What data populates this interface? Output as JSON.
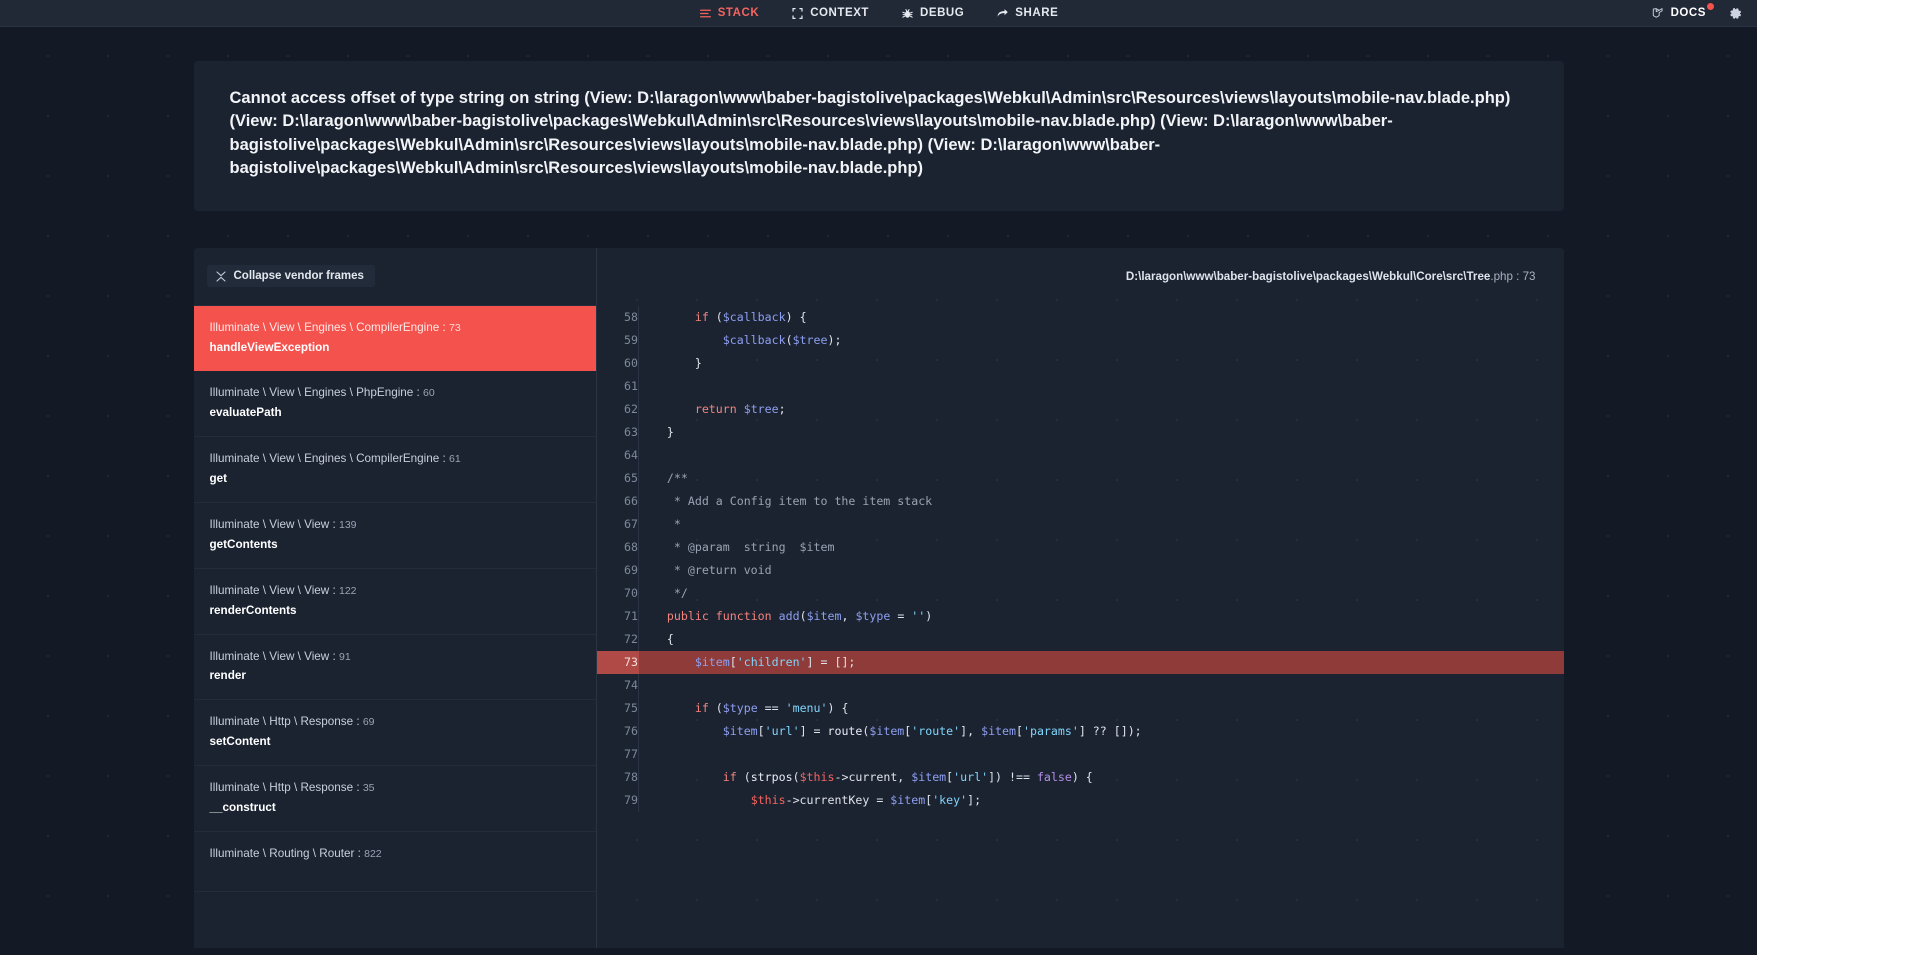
{
  "nav": {
    "items": [
      {
        "label": "STACK",
        "icon": "stack-icon",
        "active": true
      },
      {
        "label": "CONTEXT",
        "icon": "context-icon",
        "active": false
      },
      {
        "label": "DEBUG",
        "icon": "debug-icon",
        "active": false
      },
      {
        "label": "SHARE",
        "icon": "share-icon",
        "active": false
      }
    ],
    "docs_label": "DOCS",
    "docs_icon": "laravel-logo-icon",
    "docs_badge": true,
    "settings_icon": "gear-icon",
    "active_color": "#f4645f"
  },
  "exception": {
    "message": "Cannot access offset of type string on string (View: D:\\laragon\\www\\baber-bagistolive\\packages\\Webkul\\Admin\\src\\Resources\\views\\layouts\\mobile-nav.blade.php) (View: D:\\laragon\\www\\baber-bagistolive\\packages\\Webkul\\Admin\\src\\Resources\\views\\layouts\\mobile-nav.blade.php) (View: D:\\laragon\\www\\baber-bagistolive\\packages\\Webkul\\Admin\\src\\Resources\\views\\layouts\\mobile-nav.blade.php) (View: D:\\laragon\\www\\baber-bagistolive\\packages\\Webkul\\Admin\\src\\Resources\\views\\layouts\\mobile-nav.blade.php)"
  },
  "frames_panel": {
    "collapse_label": "Collapse vendor frames",
    "collapse_icon": "collapse-icon",
    "frames": [
      {
        "class": "Illuminate \\ View \\ Engines \\ CompilerEngine",
        "line": "73",
        "method": "handleViewException",
        "selected": true
      },
      {
        "class": "Illuminate \\ View \\ Engines \\ PhpEngine",
        "line": "60",
        "method": "evaluatePath",
        "selected": false
      },
      {
        "class": "Illuminate \\ View \\ Engines \\ CompilerEngine",
        "line": "61",
        "method": "get",
        "selected": false
      },
      {
        "class": "Illuminate \\ View \\ View",
        "line": "139",
        "method": "getContents",
        "selected": false
      },
      {
        "class": "Illuminate \\ View \\ View",
        "line": "122",
        "method": "renderContents",
        "selected": false
      },
      {
        "class": "Illuminate \\ View \\ View",
        "line": "91",
        "method": "render",
        "selected": false
      },
      {
        "class": "Illuminate \\ Http \\ Response",
        "line": "69",
        "method": "setContent",
        "selected": false
      },
      {
        "class": "Illuminate \\ Http \\ Response",
        "line": "35",
        "method": "__construct",
        "selected": false
      },
      {
        "class": "Illuminate \\ Routing \\ Router",
        "line": "822",
        "method": "",
        "selected": false
      }
    ]
  },
  "code_panel": {
    "file_path": "D:\\laragon\\www\\baber-bagistolive\\packages\\Webkul\\Core\\src\\Tree",
    "file_ext": ".php",
    "file_line": "73",
    "highlight_line": 73,
    "lines": [
      {
        "n": 58,
        "tokens": [
          {
            "t": "        ",
            "c": "p"
          },
          {
            "t": "if",
            "c": "k"
          },
          {
            "t": " (",
            "c": "p"
          },
          {
            "t": "$callback",
            "c": "v"
          },
          {
            "t": ") {",
            "c": "p"
          }
        ]
      },
      {
        "n": 59,
        "tokens": [
          {
            "t": "            ",
            "c": "p"
          },
          {
            "t": "$callback",
            "c": "v"
          },
          {
            "t": "(",
            "c": "p"
          },
          {
            "t": "$tree",
            "c": "v"
          },
          {
            "t": ");",
            "c": "p"
          }
        ]
      },
      {
        "n": 60,
        "tokens": [
          {
            "t": "        }",
            "c": "p"
          }
        ]
      },
      {
        "n": 61,
        "tokens": [
          {
            "t": "",
            "c": "p"
          }
        ]
      },
      {
        "n": 62,
        "tokens": [
          {
            "t": "        ",
            "c": "p"
          },
          {
            "t": "return",
            "c": "k"
          },
          {
            "t": " ",
            "c": "p"
          },
          {
            "t": "$tree",
            "c": "v"
          },
          {
            "t": ";",
            "c": "p"
          }
        ]
      },
      {
        "n": 63,
        "tokens": [
          {
            "t": "    }",
            "c": "p"
          }
        ]
      },
      {
        "n": 64,
        "tokens": [
          {
            "t": "",
            "c": "p"
          }
        ]
      },
      {
        "n": 65,
        "tokens": [
          {
            "t": "    /**",
            "c": "cm"
          }
        ]
      },
      {
        "n": 66,
        "tokens": [
          {
            "t": "     * Add a Config item to the item stack",
            "c": "cm"
          }
        ]
      },
      {
        "n": 67,
        "tokens": [
          {
            "t": "     *",
            "c": "cm"
          }
        ]
      },
      {
        "n": 68,
        "tokens": [
          {
            "t": "     * @param  string  $item",
            "c": "cm"
          }
        ]
      },
      {
        "n": 69,
        "tokens": [
          {
            "t": "     * @return void",
            "c": "cm"
          }
        ]
      },
      {
        "n": 70,
        "tokens": [
          {
            "t": "     */",
            "c": "cm"
          }
        ]
      },
      {
        "n": 71,
        "tokens": [
          {
            "t": "    ",
            "c": "p"
          },
          {
            "t": "public",
            "c": "k"
          },
          {
            "t": " ",
            "c": "p"
          },
          {
            "t": "function",
            "c": "k"
          },
          {
            "t": " ",
            "c": "p"
          },
          {
            "t": "add",
            "c": "v"
          },
          {
            "t": "(",
            "c": "p"
          },
          {
            "t": "$item",
            "c": "v"
          },
          {
            "t": ", ",
            "c": "p"
          },
          {
            "t": "$type",
            "c": "v"
          },
          {
            "t": " = ",
            "c": "p"
          },
          {
            "t": "''",
            "c": "s"
          },
          {
            "t": ")",
            "c": "p"
          }
        ]
      },
      {
        "n": 72,
        "tokens": [
          {
            "t": "    {",
            "c": "p"
          }
        ]
      },
      {
        "n": 73,
        "tokens": [
          {
            "t": "        ",
            "c": "p"
          },
          {
            "t": "$item",
            "c": "v"
          },
          {
            "t": "[",
            "c": "p"
          },
          {
            "t": "'children'",
            "c": "s"
          },
          {
            "t": "] = [];",
            "c": "p"
          }
        ]
      },
      {
        "n": 74,
        "tokens": [
          {
            "t": "",
            "c": "p"
          }
        ]
      },
      {
        "n": 75,
        "tokens": [
          {
            "t": "        ",
            "c": "p"
          },
          {
            "t": "if",
            "c": "k"
          },
          {
            "t": " (",
            "c": "p"
          },
          {
            "t": "$type",
            "c": "v"
          },
          {
            "t": " == ",
            "c": "p"
          },
          {
            "t": "'menu'",
            "c": "s"
          },
          {
            "t": ") {",
            "c": "p"
          }
        ]
      },
      {
        "n": 76,
        "tokens": [
          {
            "t": "            ",
            "c": "p"
          },
          {
            "t": "$item",
            "c": "v"
          },
          {
            "t": "[",
            "c": "p"
          },
          {
            "t": "'url'",
            "c": "s"
          },
          {
            "t": "] = ",
            "c": "p"
          },
          {
            "t": "route",
            "c": "fn"
          },
          {
            "t": "(",
            "c": "p"
          },
          {
            "t": "$item",
            "c": "v"
          },
          {
            "t": "[",
            "c": "p"
          },
          {
            "t": "'route'",
            "c": "s"
          },
          {
            "t": "], ",
            "c": "p"
          },
          {
            "t": "$item",
            "c": "v"
          },
          {
            "t": "[",
            "c": "p"
          },
          {
            "t": "'params'",
            "c": "s"
          },
          {
            "t": "] ?? []);",
            "c": "p"
          }
        ]
      },
      {
        "n": 77,
        "tokens": [
          {
            "t": "",
            "c": "p"
          }
        ]
      },
      {
        "n": 78,
        "tokens": [
          {
            "t": "            ",
            "c": "p"
          },
          {
            "t": "if",
            "c": "k"
          },
          {
            "t": " (",
            "c": "p"
          },
          {
            "t": "strpos",
            "c": "fn"
          },
          {
            "t": "(",
            "c": "p"
          },
          {
            "t": "$this",
            "c": "th"
          },
          {
            "t": "->current, ",
            "c": "p"
          },
          {
            "t": "$item",
            "c": "v"
          },
          {
            "t": "[",
            "c": "p"
          },
          {
            "t": "'url'",
            "c": "s"
          },
          {
            "t": "]) !== ",
            "c": "p"
          },
          {
            "t": "false",
            "c": "pu"
          },
          {
            "t": ") {",
            "c": "p"
          }
        ]
      },
      {
        "n": 79,
        "tokens": [
          {
            "t": "                ",
            "c": "p"
          },
          {
            "t": "$this",
            "c": "th"
          },
          {
            "t": "->currentKey = ",
            "c": "p"
          },
          {
            "t": "$item",
            "c": "v"
          },
          {
            "t": "[",
            "c": "p"
          },
          {
            "t": "'key'",
            "c": "s"
          },
          {
            "t": "];",
            "c": "p"
          }
        ]
      }
    ]
  }
}
